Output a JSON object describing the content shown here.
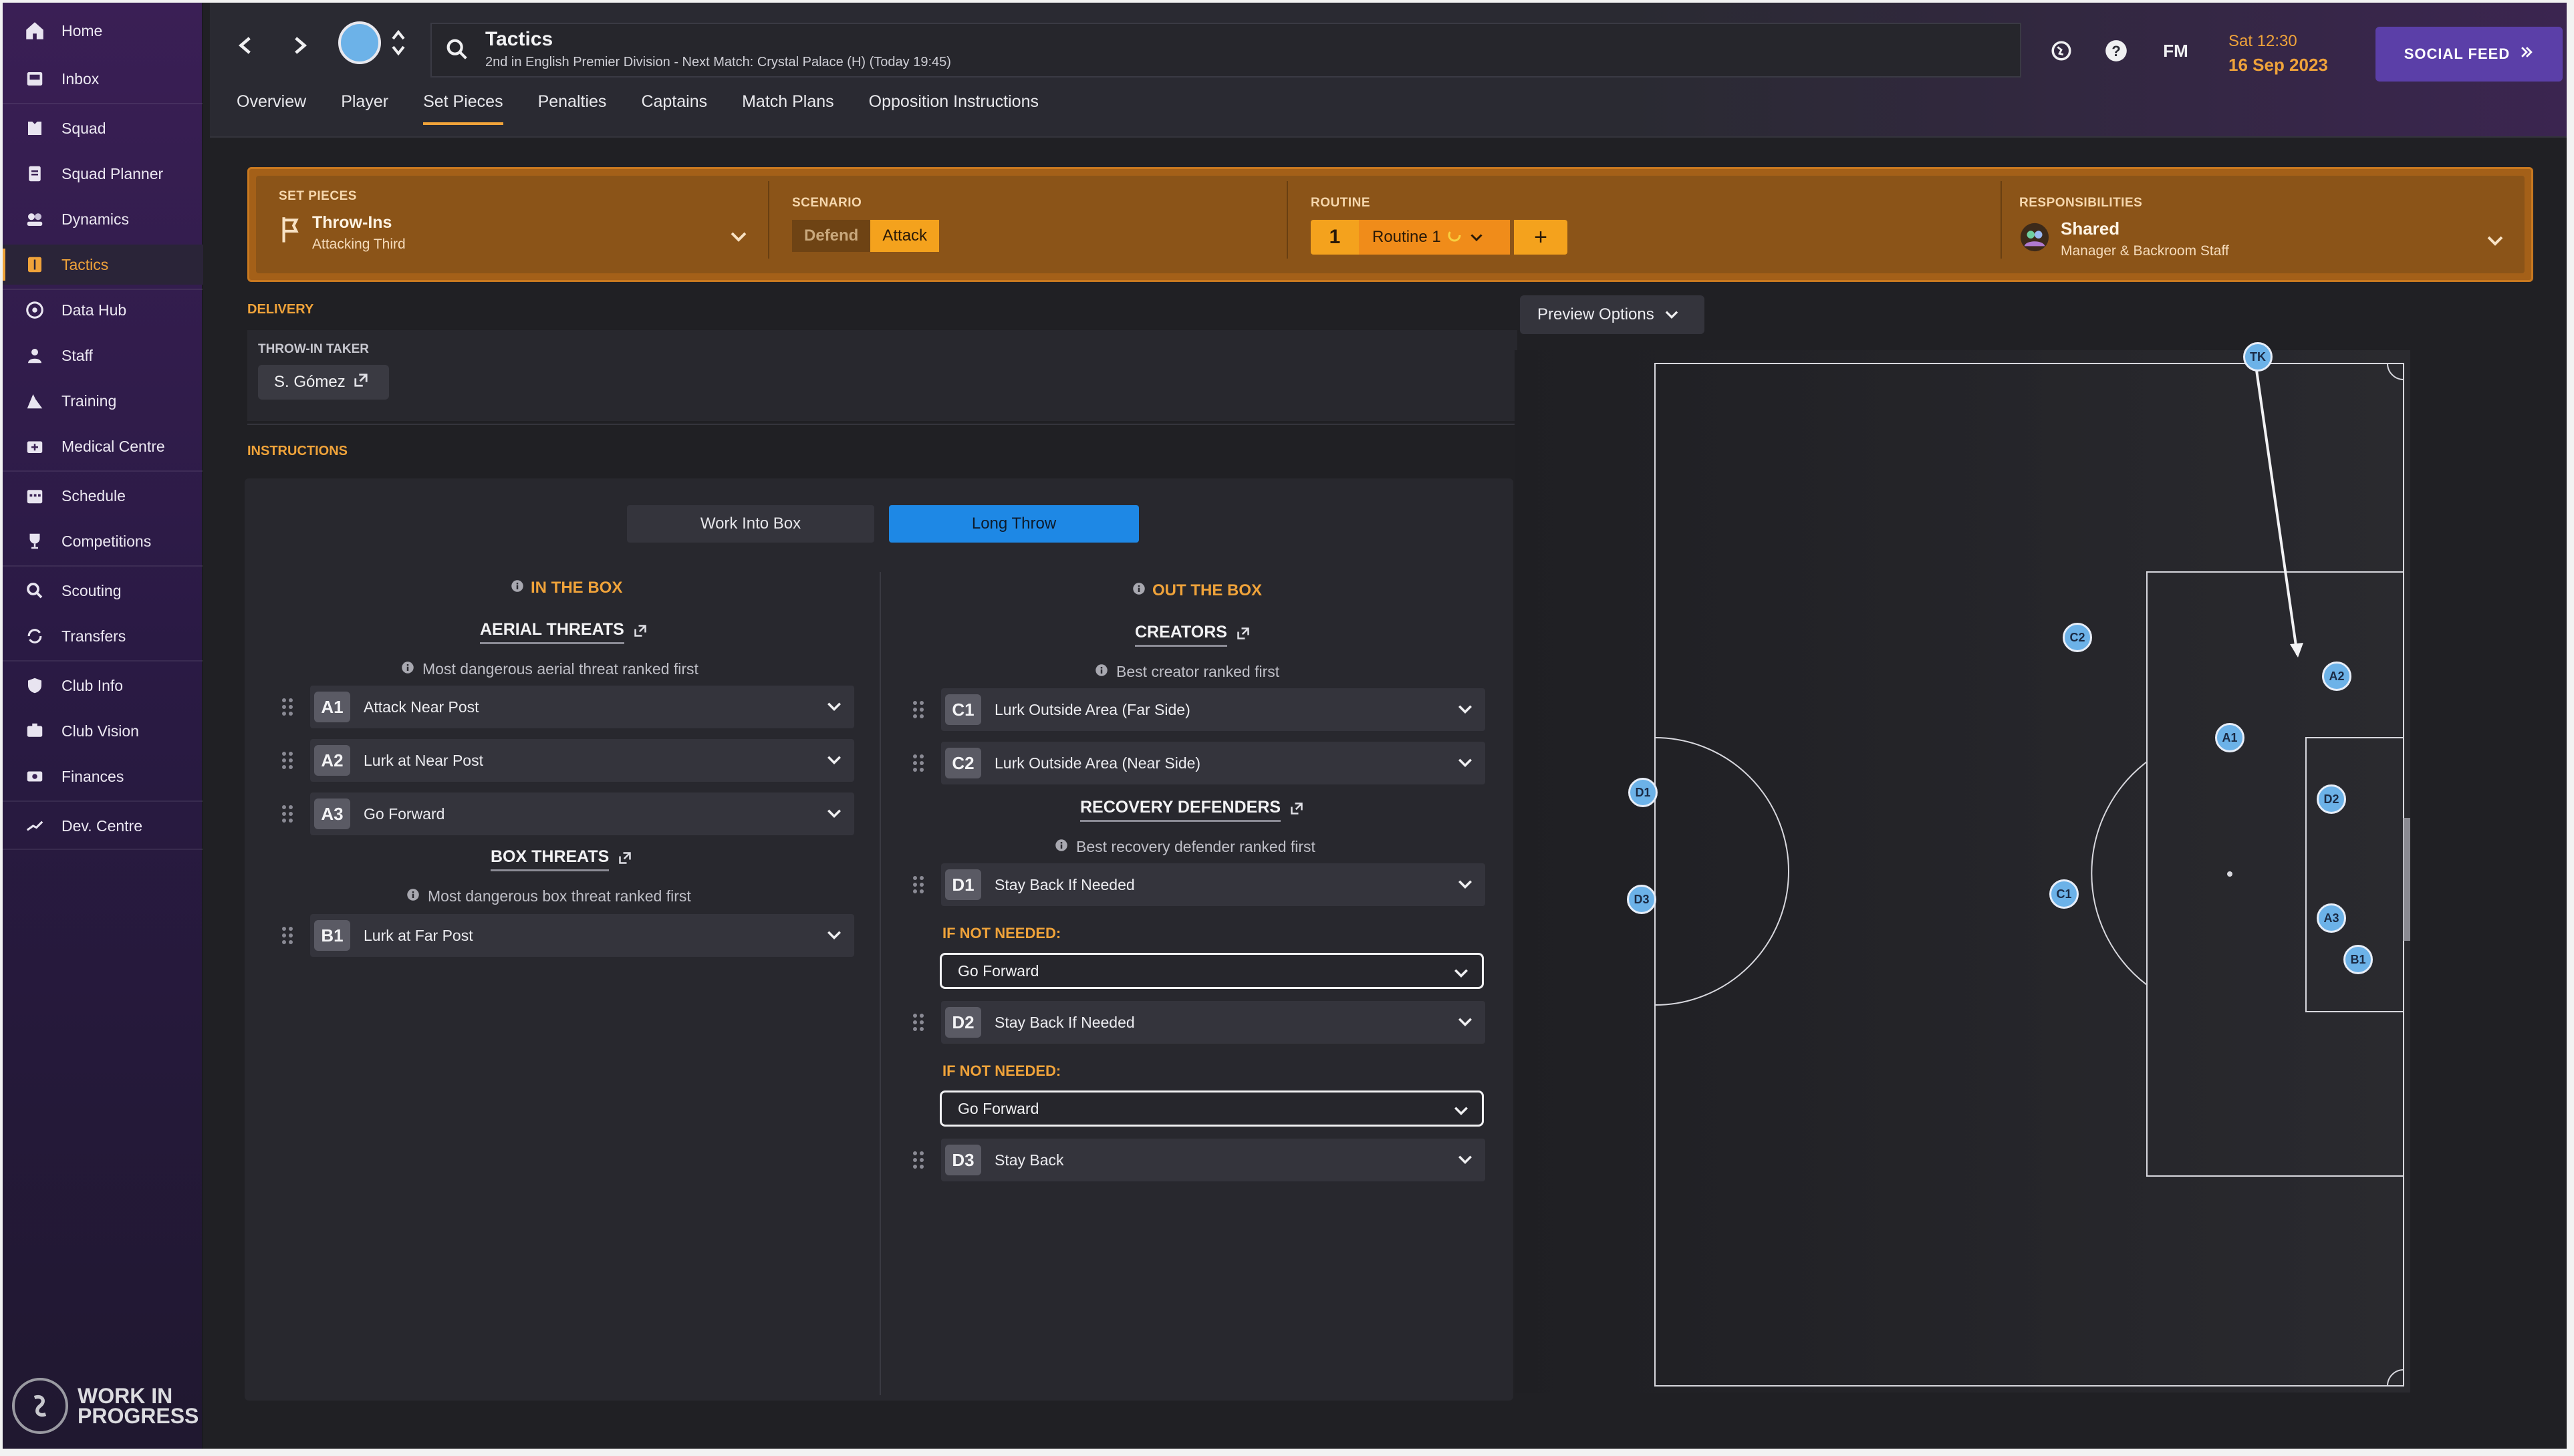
{
  "sidebar": {
    "items": [
      {
        "label": "Home",
        "icon": "home-icon"
      },
      {
        "label": "Inbox",
        "icon": "inbox-icon"
      },
      {
        "label": "Squad",
        "icon": "squad-icon"
      },
      {
        "label": "Squad Planner",
        "icon": "clipboard-icon"
      },
      {
        "label": "Dynamics",
        "icon": "dynamics-icon"
      },
      {
        "label": "Tactics",
        "icon": "tactics-icon"
      },
      {
        "label": "Data Hub",
        "icon": "data-hub-icon"
      },
      {
        "label": "Staff",
        "icon": "staff-icon"
      },
      {
        "label": "Training",
        "icon": "training-icon"
      },
      {
        "label": "Medical Centre",
        "icon": "medical-icon"
      },
      {
        "label": "Schedule",
        "icon": "calendar-icon"
      },
      {
        "label": "Competitions",
        "icon": "trophy-icon"
      },
      {
        "label": "Scouting",
        "icon": "search-icon"
      },
      {
        "label": "Transfers",
        "icon": "transfers-icon"
      },
      {
        "label": "Club Info",
        "icon": "shield-icon"
      },
      {
        "label": "Club Vision",
        "icon": "vision-icon"
      },
      {
        "label": "Finances",
        "icon": "finances-icon"
      },
      {
        "label": "Dev. Centre",
        "icon": "dev-centre-icon"
      }
    ],
    "active": "Tactics",
    "footer": {
      "line1": "WORK IN",
      "line2": "PROGRESS"
    }
  },
  "header": {
    "title": "Tactics",
    "subtitle": "2nd in English Premier Division - Next Match: Crystal Palace (H) (Today 19:45)",
    "time": "Sat 12:30",
    "date": "16 Sep 2023",
    "fm_label": "FM",
    "social_feed": "SOCIAL FEED",
    "tabs": [
      "Overview",
      "Player",
      "Set Pieces",
      "Penalties",
      "Captains",
      "Match Plans",
      "Opposition Instructions"
    ],
    "active_tab": "Set Pieces"
  },
  "setpieces": {
    "label": "SET PIECES",
    "type": "Throw-Ins",
    "zone": "Attacking Third",
    "scenario_label": "SCENARIO",
    "scenario_options": [
      "Defend",
      "Attack"
    ],
    "scenario_selected": "Attack",
    "routine_label": "ROUTINE",
    "routine_number": "1",
    "routine_name": "Routine 1",
    "add_label": "+",
    "responsibilities_label": "RESPONSIBILITIES",
    "responsibilities_value": "Shared",
    "responsibilities_sub": "Manager & Backroom Staff"
  },
  "delivery": {
    "heading": "DELIVERY",
    "taker_label": "THROW-IN TAKER",
    "taker": "S. Gómez"
  },
  "instructions": {
    "heading": "INSTRUCTIONS",
    "toggle_options": [
      "Work Into Box",
      "Long Throw"
    ],
    "toggle_selected": "Long Throw",
    "in_box": {
      "heading": "IN THE BOX",
      "aerial": {
        "title": "AERIAL THREATS",
        "hint": "Most dangerous aerial threat ranked first",
        "rows": [
          {
            "code": "A1",
            "value": "Attack Near Post"
          },
          {
            "code": "A2",
            "value": "Lurk at Near Post"
          },
          {
            "code": "A3",
            "value": "Go Forward"
          }
        ]
      },
      "box": {
        "title": "BOX THREATS",
        "hint": "Most dangerous box threat ranked first",
        "rows": [
          {
            "code": "B1",
            "value": "Lurk at Far Post"
          }
        ]
      }
    },
    "out_box": {
      "heading": "OUT THE BOX",
      "creators": {
        "title": "CREATORS",
        "hint": "Best creator ranked first",
        "rows": [
          {
            "code": "C1",
            "value": "Lurk Outside Area (Far Side)"
          },
          {
            "code": "C2",
            "value": "Lurk Outside Area (Near Side)"
          }
        ]
      },
      "recovery": {
        "title": "RECOVERY DEFENDERS",
        "hint": "Best recovery defender ranked first",
        "rows": [
          {
            "code": "D1",
            "value": "Stay Back If Needed",
            "if_not_needed": "Go Forward"
          },
          {
            "code": "D2",
            "value": "Stay Back If Needed",
            "if_not_needed": "Go Forward"
          },
          {
            "code": "D3",
            "value": "Stay Back"
          }
        ],
        "if_not_label": "IF NOT NEEDED:"
      }
    }
  },
  "preview": {
    "button": "Preview Options",
    "markers": [
      "TK",
      "C2",
      "A2",
      "A1",
      "D2",
      "D1",
      "C1",
      "D3",
      "A3",
      "B1"
    ]
  },
  "colors": {
    "accent": "#f0a33a",
    "setpiece_bar": "#8b5418",
    "toggle_active": "#1e88e5",
    "social_button": "#5b3fa8",
    "marker": "#6cb2e8"
  }
}
